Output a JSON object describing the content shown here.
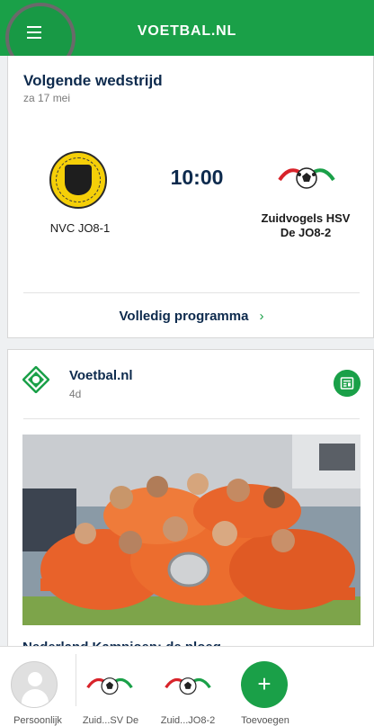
{
  "header": {
    "title": "VOETBAL.NL"
  },
  "next_match": {
    "title": "Volgende wedstrijd",
    "date": "za 17 mei",
    "kickoff": "10:00",
    "home_team": "NVC JO8-1",
    "away_team_line1": "Zuidvogels HSV",
    "away_team_line2": "De JO8-2",
    "full_program_label": "Volledig programma",
    "chevron": "›"
  },
  "news": {
    "source": "Voetbal.nl",
    "age": "4d",
    "headline": "Nederland Kampioen: de ploeg"
  },
  "bottom_nav": {
    "items": [
      {
        "label": "Persoonlijk"
      },
      {
        "label": "Zuid...SV De"
      },
      {
        "label": "Zuid...JO8-2"
      },
      {
        "label": "Toevoegen"
      }
    ],
    "add_symbol": "+"
  },
  "colors": {
    "brand_green": "#1aa048",
    "navy_text": "#0d2a4d"
  }
}
